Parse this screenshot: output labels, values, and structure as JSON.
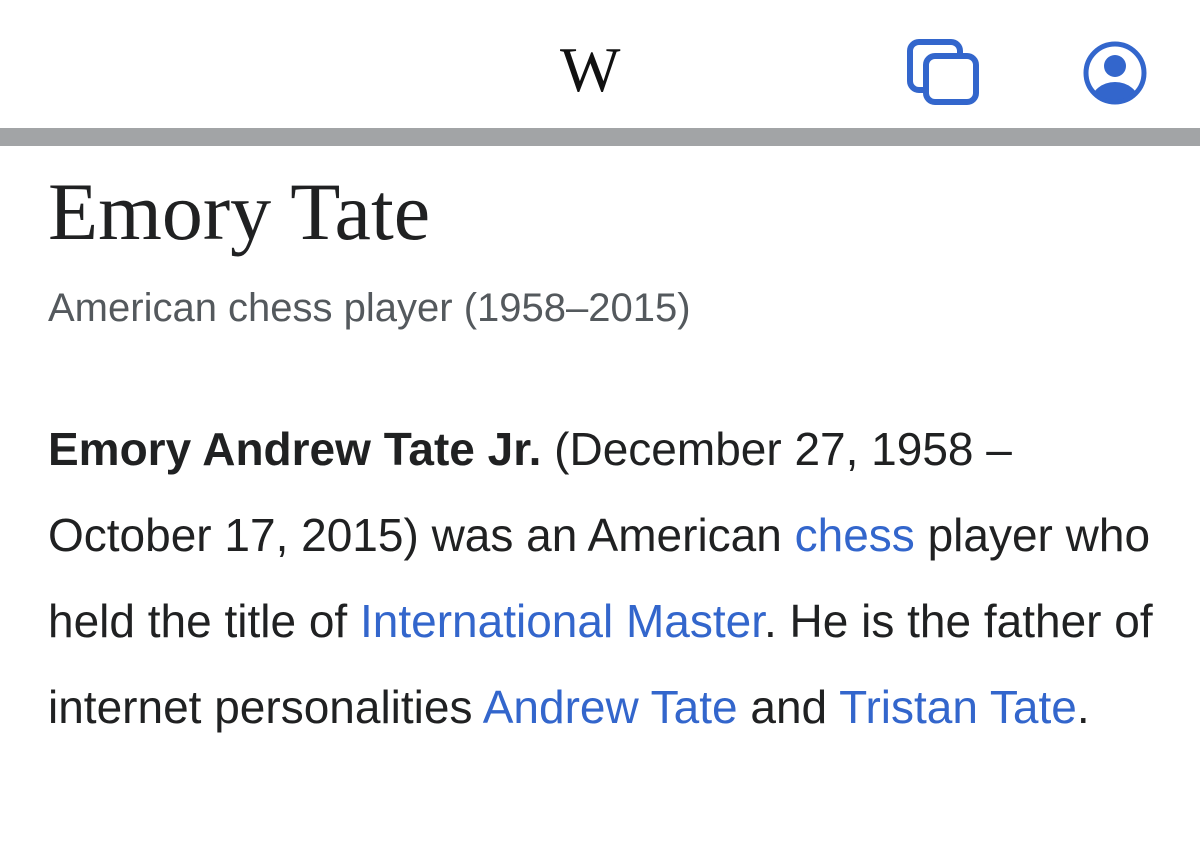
{
  "header": {
    "logo": "W",
    "tabs_icon": "tabs-icon",
    "user_icon": "user-account-icon",
    "accent_color": "#3366cc"
  },
  "article": {
    "title": "Emory Tate",
    "description": "American chess player (1958–2015)",
    "lead": {
      "bold_name": "Emory Andrew Tate Jr.",
      "text_1": " (December 27, 1958 – October 17, 2015) was an American ",
      "link_chess": "chess",
      "text_2": " player who held the title of ",
      "link_im": "International Master",
      "text_3": ". He is the father of internet personalities ",
      "link_andrew": "Andrew Tate",
      "text_4": " and ",
      "link_tristan": "Tristan Tate",
      "text_5": "."
    }
  }
}
